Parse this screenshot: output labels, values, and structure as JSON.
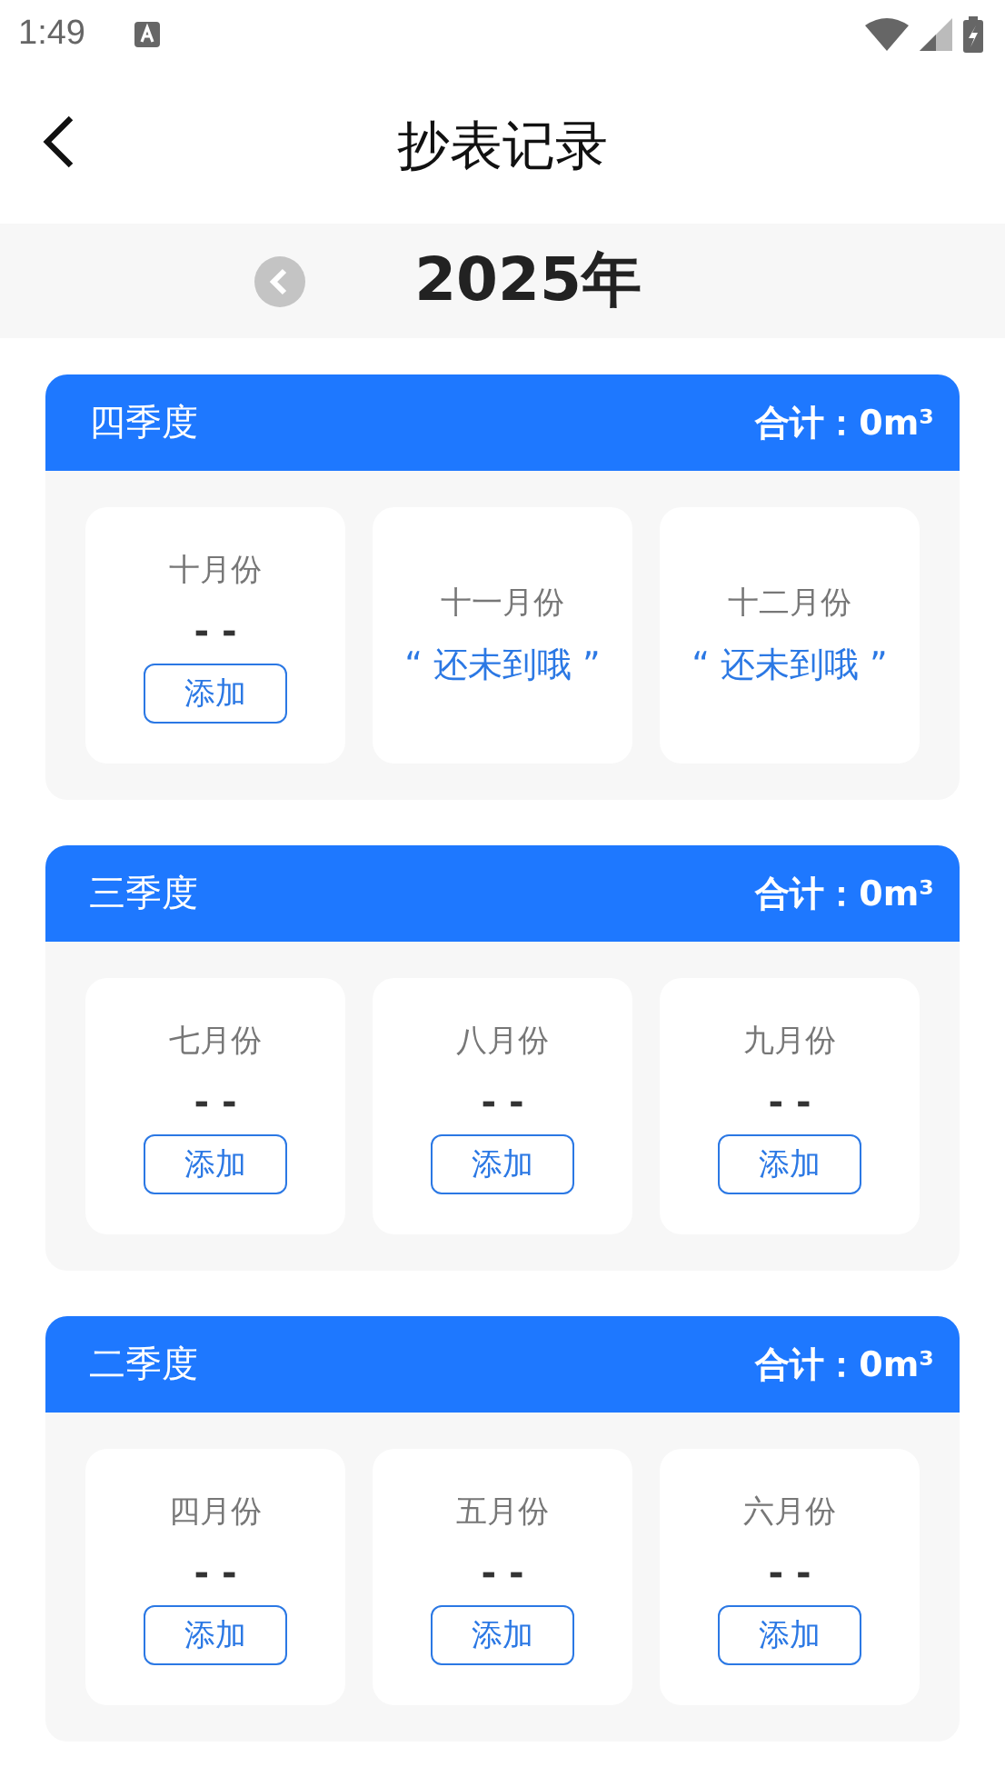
{
  "status_bar": {
    "time": "1:49"
  },
  "header": {
    "title": "抄表记录"
  },
  "year_bar": {
    "year": "2025年"
  },
  "quarters": [
    {
      "name": "四季度",
      "total": "合计：0m³",
      "months": [
        {
          "kind": "pending",
          "label": "十月份",
          "reading": "- -",
          "button": "添加"
        },
        {
          "kind": "future",
          "label": "十一月份",
          "note": "“ 还未到哦 ”"
        },
        {
          "kind": "future",
          "label": "十二月份",
          "note": "“ 还未到哦 ”"
        }
      ]
    },
    {
      "name": "三季度",
      "total": "合计：0m³",
      "months": [
        {
          "kind": "pending",
          "label": "七月份",
          "reading": "- -",
          "button": "添加"
        },
        {
          "kind": "pending",
          "label": "八月份",
          "reading": "- -",
          "button": "添加"
        },
        {
          "kind": "pending",
          "label": "九月份",
          "reading": "- -",
          "button": "添加"
        }
      ]
    },
    {
      "name": "二季度",
      "total": "合计：0m³",
      "months": [
        {
          "kind": "pending",
          "label": "四月份",
          "reading": "- -",
          "button": "添加"
        },
        {
          "kind": "pending",
          "label": "五月份",
          "reading": "- -",
          "button": "添加"
        },
        {
          "kind": "pending",
          "label": "六月份",
          "reading": "- -",
          "button": "添加"
        }
      ]
    }
  ]
}
